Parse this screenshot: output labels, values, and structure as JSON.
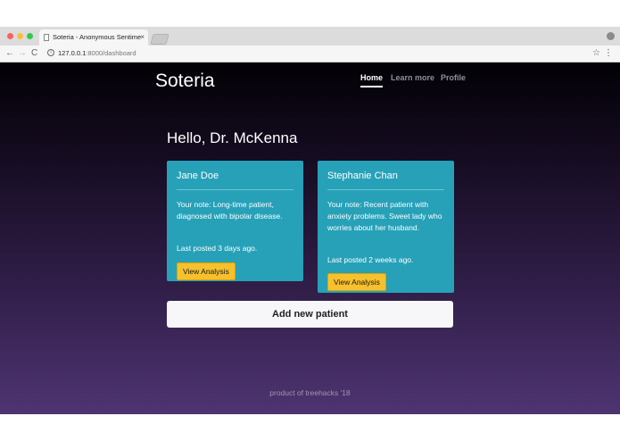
{
  "browser": {
    "tab_title": "Soteria - Anonymous Sentime",
    "tab_close": "×",
    "url_host": "127.0.0.1",
    "url_rest": ":8000/dashboard",
    "back_glyph": "←",
    "forward_glyph": "→",
    "reload_glyph": "C",
    "info_glyph": "i",
    "star_glyph": "☆",
    "menu_glyph": "⋮"
  },
  "navbar": {
    "brand": "Soteria",
    "links": [
      "Home",
      "Learn more",
      "Profile"
    ]
  },
  "greeting": "Hello, Dr. McKenna",
  "patients": [
    {
      "name": "Jane Doe",
      "note": "Your note: Long-time patient, diagnosed with bipolar disease.",
      "last_posted": "Last posted 3 days ago.",
      "button": "View Analysis"
    },
    {
      "name": "Stephanie Chan",
      "note": "Your note: Recent patient with anxiety problems. Sweet lady who worries about her husband.",
      "last_posted": "Last posted 2 weeks ago.",
      "button": "View Analysis"
    }
  ],
  "add_patient_button": "Add new patient",
  "footer": "product of treehacks '18",
  "colors": {
    "card": "#26a1b8",
    "button": "#f6c12d",
    "gradient_top": "#020105",
    "gradient_bottom": "#4e3471"
  }
}
